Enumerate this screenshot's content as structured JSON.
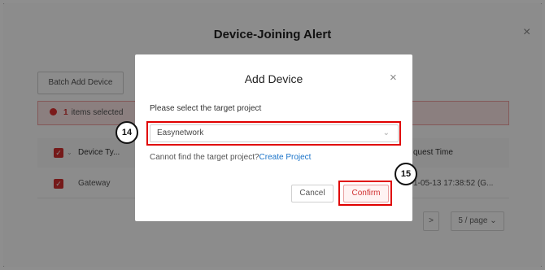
{
  "outer_modal": {
    "title": "Device-Joining Alert",
    "close_glyph": "×",
    "batch_button": "Batch Add Device",
    "alert": {
      "count": "1",
      "text": "items selected"
    },
    "table": {
      "headers": [
        "Device Ty...",
        "quest Time"
      ],
      "row": {
        "type": "Gateway",
        "time": "1-05-13 17:38:52 (G..."
      }
    },
    "pagination": {
      "next": ">",
      "page_size": "5 / page"
    }
  },
  "add_device": {
    "title": "Add Device",
    "close_glyph": "×",
    "select_label": "Please select the target project",
    "select_value": "Easynetwork",
    "hint": "Cannot find the target project?",
    "create_link": "Create Project",
    "cancel": "Cancel",
    "confirm": "Confirm"
  },
  "annotations": {
    "select_marker": "14",
    "confirm_marker": "15"
  },
  "colors": {
    "accent": "#d63030",
    "annotation": "#e00000",
    "link": "#1a73c9"
  }
}
